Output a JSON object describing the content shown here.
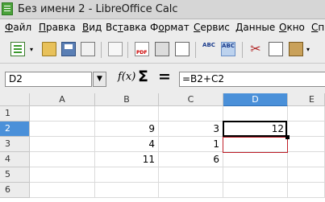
{
  "window": {
    "title": "Без имени 2 - LibreOffice Calc"
  },
  "menu": {
    "items": [
      {
        "label": "Файл",
        "mnemonic_index": 0
      },
      {
        "label": "Правка",
        "mnemonic_index": 0
      },
      {
        "label": "Вид",
        "mnemonic_index": 0
      },
      {
        "label": "Вставка",
        "mnemonic_index": 2
      },
      {
        "label": "Формат",
        "mnemonic_index": 1
      },
      {
        "label": "Сервис",
        "mnemonic_index": 0
      },
      {
        "label": "Данные",
        "mnemonic_index": 0
      },
      {
        "label": "Окно",
        "mnemonic_index": 0
      },
      {
        "label": "Сп",
        "mnemonic_index": 0
      }
    ]
  },
  "toolbar": {
    "icons": [
      "new-spreadsheet-icon",
      "open-folder-icon",
      "save-icon",
      "email-icon",
      "edit-file-icon",
      "export-pdf-icon",
      "print-icon",
      "page-preview-icon",
      "spelling-icon",
      "autospell-icon",
      "cut-icon",
      "copy-icon",
      "paste-icon"
    ],
    "spell_label": "ABC",
    "autospell_label": "ABC",
    "autospell_active": true
  },
  "formula_bar": {
    "name_box_value": "D2",
    "function_wizard_label": "f(x)",
    "sum_label": "Σ",
    "equals_label": "=",
    "formula_value": "=B2+C2"
  },
  "sheet": {
    "columns": [
      "A",
      "B",
      "C",
      "D",
      "E"
    ],
    "active_column": "D",
    "rows": [
      {
        "number": "1",
        "cells": [
          "",
          "",
          "",
          ""
        ]
      },
      {
        "number": "2",
        "cells": [
          "",
          "9",
          "3",
          "12"
        ]
      },
      {
        "number": "3",
        "cells": [
          "",
          "4",
          "1",
          ""
        ]
      },
      {
        "number": "4",
        "cells": [
          "",
          "11",
          "6",
          ""
        ]
      },
      {
        "number": "5",
        "cells": [
          "",
          "",
          "",
          ""
        ]
      },
      {
        "number": "6",
        "cells": [
          "",
          "",
          "",
          ""
        ]
      }
    ],
    "active_row": "2",
    "active_cell": "D2",
    "reference_highlight_color": "#c0202a",
    "selection_header_color": "#4a90d9"
  }
}
